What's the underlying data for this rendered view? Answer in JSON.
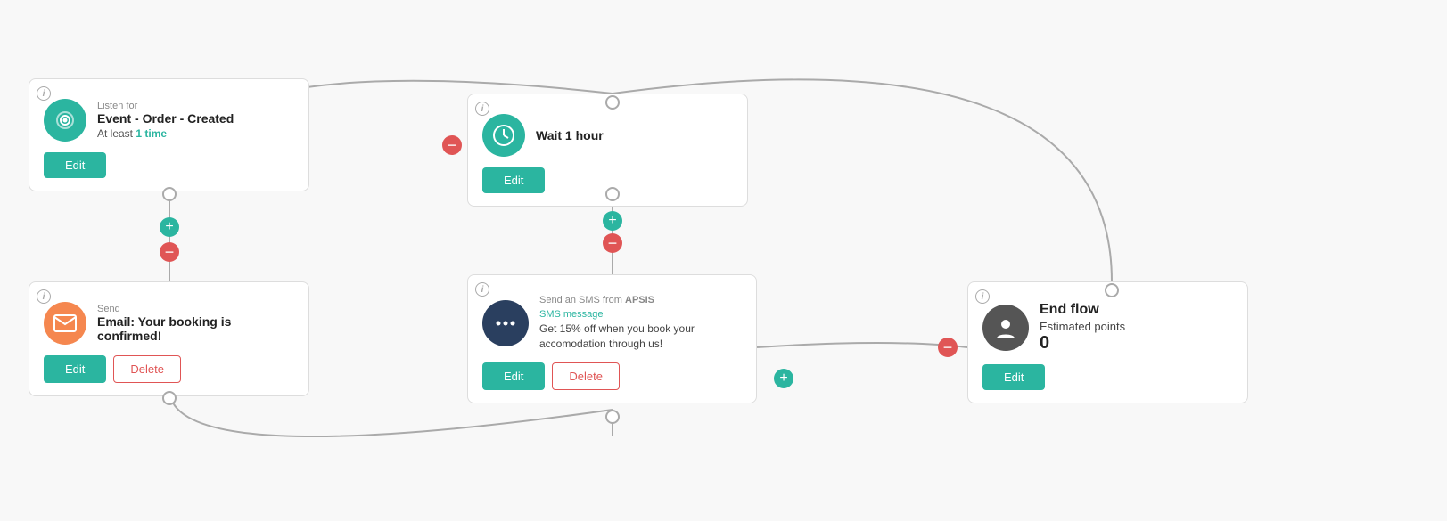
{
  "nodes": {
    "listen": {
      "label": "Listen for",
      "title": "Event - Order - Created",
      "subtitle_prefix": "At least ",
      "subtitle_highlight": "1 time",
      "icon_color": "#2bb5a0",
      "edit_label": "Edit"
    },
    "email": {
      "label": "Send",
      "title": "Email: Your booking is confirmed!",
      "icon_color": "#f5874f",
      "edit_label": "Edit",
      "delete_label": "Delete"
    },
    "wait": {
      "label": "Wait ",
      "title_bold": "1 hour",
      "icon_color": "#2bb5a0",
      "edit_label": "Edit"
    },
    "sms": {
      "label": "Send an SMS from ",
      "label_brand": "APSIS",
      "message_label": "SMS message",
      "message_text": "Get 15% off when you book your accomodation through us!",
      "icon_color": "#2a3f5f",
      "edit_label": "Edit",
      "delete_label": "Delete"
    },
    "end": {
      "title": "End flow",
      "subtitle": "Estimated points",
      "points": "0",
      "icon_color": "#555",
      "edit_label": "Edit"
    }
  },
  "colors": {
    "teal": "#2bb5a0",
    "red": "#e05555",
    "orange": "#f5874f",
    "dark": "#2a3f5f",
    "gray": "#aaa"
  }
}
